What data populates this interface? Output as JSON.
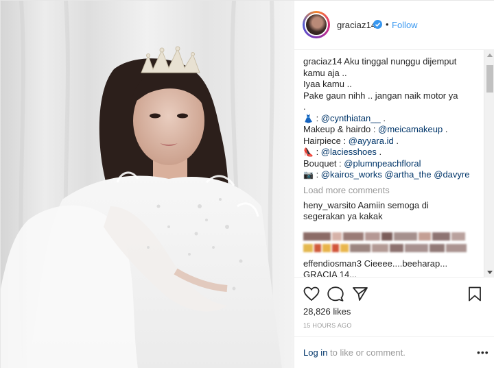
{
  "header": {
    "username": "graciaz14",
    "separator": "•",
    "follow_label": "Follow"
  },
  "caption": {
    "username": "graciaz14",
    "line1": "Aku tinggal nunggu dijemput",
    "line2": "kamu aja ..",
    "line3": "Iyaa kamu ..",
    "line4": "Pake gaun nihh .. jangan naik motor ya",
    "line5": ".",
    "dress_emoji": "👗",
    "dress_sep": " : ",
    "dress_link": "@cynthiatan__",
    "dress_end": " .",
    "makeup_label": "Makeup & hairdo : ",
    "makeup_link": "@meicamakeup",
    "makeup_end": " .",
    "hairpiece_label": "Hairpiece : ",
    "hairpiece_link": "@ayyara.id",
    "hairpiece_end": " .",
    "shoe_emoji": "👠",
    "shoe_sep": " : ",
    "shoe_link": "@laciesshoes",
    "shoe_end": " .",
    "bouquet_label": "Bouquet : ",
    "bouquet_link": "@plumnpeachfloral",
    "camera_emoji": "📷",
    "camera_sep": " : ",
    "camera_link1": "@kairos_works",
    "camera_link2": "@artha_the",
    "camera_link3": "@davyre"
  },
  "load_more": "Load more comments",
  "comments": [
    {
      "username": "heny_warsito",
      "text": "Aamiin semoga di",
      "text2": "segerakan ya kakak"
    },
    {
      "username": "effendiosman3",
      "text": "Cieeee....beeharap...",
      "text2": "GRACIA 14..."
    }
  ],
  "likes": "28,826 likes",
  "timestamp": "15 HOURS AGO",
  "login": {
    "link": "Log in",
    "rest": " to like or comment."
  },
  "more_dots": "•••",
  "colors": {
    "link": "#003569",
    "follow": "#3897f0",
    "muted": "#999999",
    "text": "#262626"
  }
}
